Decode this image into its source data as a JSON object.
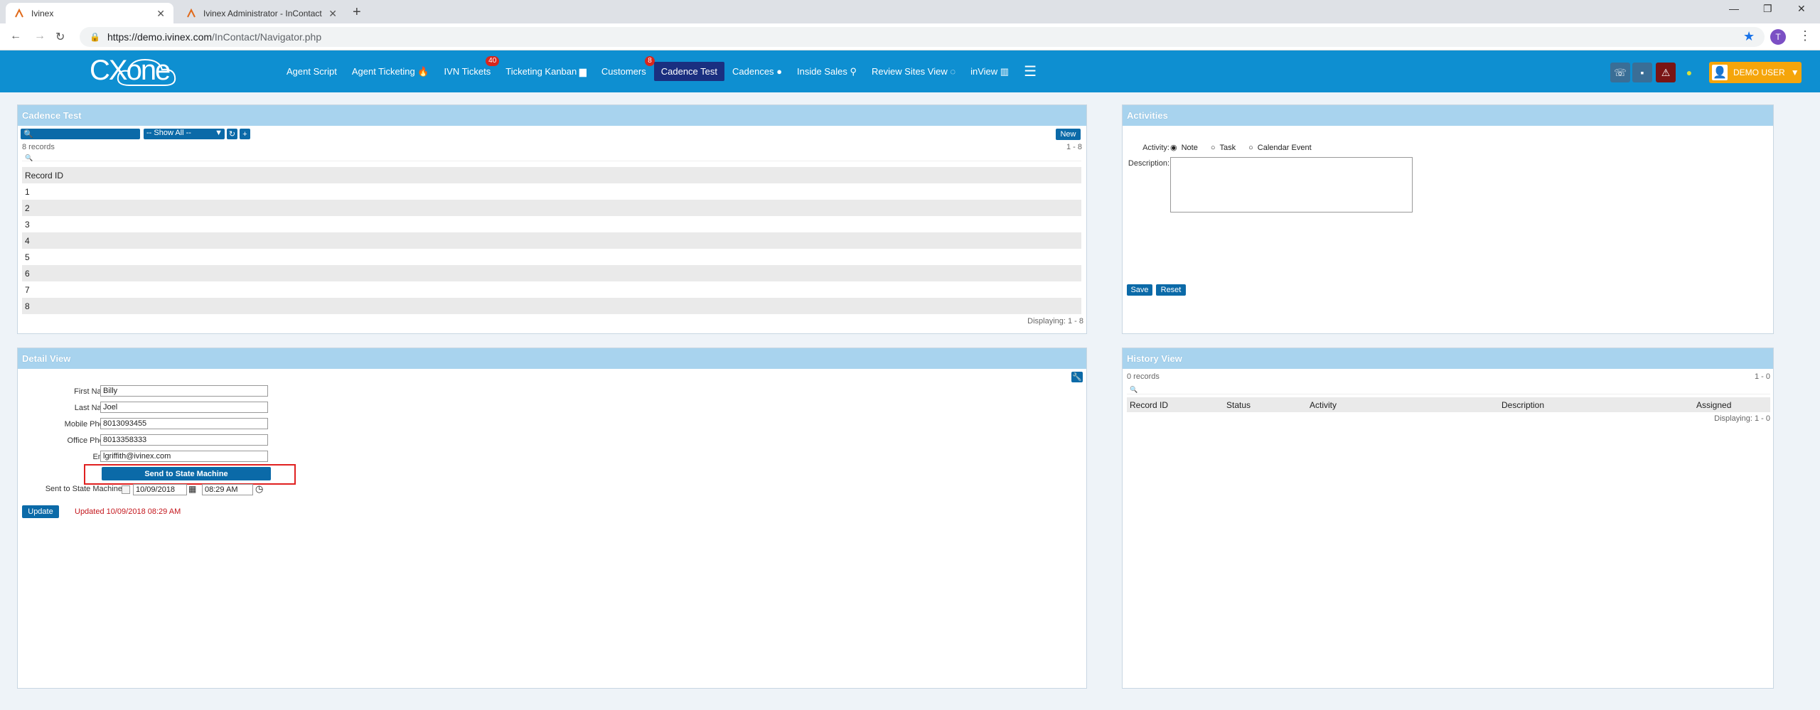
{
  "browser": {
    "tabs": [
      {
        "title": "Ivinex",
        "active": true
      },
      {
        "title": "Ivinex Administrator - InContact",
        "active": false
      }
    ],
    "url_host": "https://demo.ivinex.com",
    "url_path": "/InContact/Navigator.php",
    "profile_initial": "T"
  },
  "app": {
    "logo_text": "CXone",
    "nav": [
      {
        "label": "Agent Script",
        "icon": "",
        "badge": ""
      },
      {
        "label": "Agent Ticketing",
        "icon": "flame",
        "badge": ""
      },
      {
        "label": "IVN Tickets",
        "icon": "",
        "badge": "40"
      },
      {
        "label": "Ticketing Kanban",
        "icon": "folder",
        "badge": ""
      },
      {
        "label": "Customers",
        "icon": "",
        "badge": "8"
      },
      {
        "label": "Cadence Test",
        "icon": "",
        "badge": "",
        "active": true
      },
      {
        "label": "Cadences",
        "icon": "drop",
        "badge": ""
      },
      {
        "label": "Inside Sales",
        "icon": "pin",
        "badge": ""
      },
      {
        "label": "Review Sites View",
        "icon": "chat",
        "badge": ""
      },
      {
        "label": "inView",
        "icon": "chart",
        "badge": ""
      }
    ],
    "user_label": "DEMO USER"
  },
  "cadence_panel": {
    "title": "Cadence Test",
    "filter_label": "-- Show All --",
    "new_label": "New",
    "records_count": "8 records",
    "range": "1 - 8",
    "column": "Record ID",
    "rows": [
      "1",
      "2",
      "3",
      "4",
      "5",
      "6",
      "7",
      "8"
    ],
    "footer": "Displaying: 1 - 8"
  },
  "activities_panel": {
    "title": "Activities",
    "activity_label": "Activity:",
    "options": [
      "Note",
      "Task",
      "Calendar Event"
    ],
    "description_label": "Description:",
    "save_label": "Save",
    "reset_label": "Reset"
  },
  "detail_panel": {
    "title": "Detail View",
    "fields": [
      {
        "label": "First Name:",
        "value": "Billy"
      },
      {
        "label": "Last Name:",
        "value": "Joel"
      },
      {
        "label": "Mobile Phone:",
        "value": "8013093455"
      },
      {
        "label": "Office Phone:",
        "value": "8013358333"
      },
      {
        "label": "Email:",
        "value": "lgriffith@ivinex.com"
      }
    ],
    "send_button": "Send to State Machine",
    "sent_label": "Sent to State Machine:",
    "sent_date": "10/09/2018",
    "sent_time": "08:29 AM",
    "update_label": "Update",
    "updated_text": "Updated 10/09/2018 08:29 AM"
  },
  "history_panel": {
    "title": "History View",
    "records_count": "0 records",
    "range": "1 - 0",
    "columns": [
      "Record ID",
      "Status",
      "Activity",
      "Description",
      "Assigned"
    ],
    "footer": "Displaying: 1 - 0"
  }
}
